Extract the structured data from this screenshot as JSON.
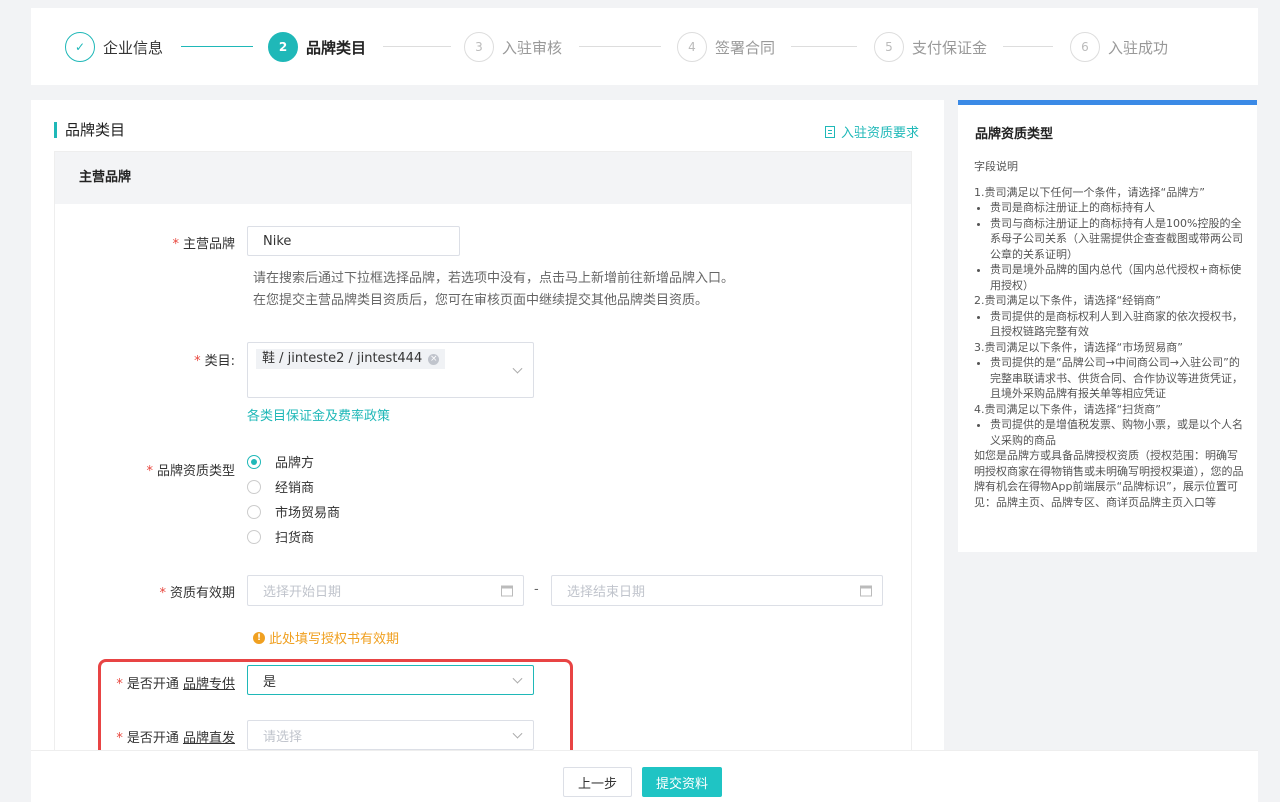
{
  "steps": [
    {
      "num": "✓",
      "label": "企业信息",
      "state": "done"
    },
    {
      "num": "2",
      "label": "品牌类目",
      "state": "active"
    },
    {
      "num": "3",
      "label": "入驻审核",
      "state": "todo"
    },
    {
      "num": "4",
      "label": "签署合同",
      "state": "todo"
    },
    {
      "num": "5",
      "label": "支付保证金",
      "state": "todo"
    },
    {
      "num": "6",
      "label": "入驻成功",
      "state": "todo"
    }
  ],
  "main": {
    "title": "品牌类目",
    "requirements_link": "入驻资质要求",
    "box_title": "主营品牌",
    "brand": {
      "label": "主营品牌",
      "value": "Nike",
      "hint_1": "请在搜索后通过下拉框选择品牌，若选项中没有，点击马上新增前往新增品牌入口。",
      "hint_2": "在您提交主营品牌类目资质后，您可在审核页面中继续提交其他品牌类目资质。"
    },
    "category": {
      "label": "类目:",
      "tag": "鞋 / jinteste2 / jintest444",
      "policy_link": "各类目保证金及费率政策"
    },
    "qualification": {
      "label": "品牌资质类型",
      "options": [
        "品牌方",
        "经销商",
        "市场贸易商",
        "扫货商"
      ],
      "selected": "品牌方"
    },
    "validity": {
      "label": "资质有效期",
      "start_placeholder": "选择开始日期",
      "separator": "-",
      "end_placeholder": "选择结束日期",
      "warning": "此处填写授权书有效期"
    },
    "exclusive": {
      "label_prefix": "是否开通",
      "label_link": "品牌专供",
      "value": "是"
    },
    "direct": {
      "label_prefix": "是否开通",
      "label_link": "品牌直发",
      "placeholder": "请选择"
    }
  },
  "side": {
    "title": "品牌资质类型",
    "subtitle": "字段说明",
    "s1": "1.贵司满足以下任何一个条件，请选择“品牌方”",
    "s1_items": [
      "贵司是商标注册证上的商标持有人",
      "贵司与商标注册证上的商标持有人是100%控股的全系母子公司关系（入驻需提供企查查截图或带两公司公章的关系证明）",
      "贵司是境外品牌的国内总代（国内总代授权+商标使用授权）"
    ],
    "s2": "2.贵司满足以下条件，请选择“经销商”",
    "s2_items": [
      "贵司提供的是商标权利人到入驻商家的依次授权书，且授权链路完整有效"
    ],
    "s3": "3.贵司满足以下条件，请选择“市场贸易商”",
    "s3_items": [
      "贵司提供的是“品牌公司→中间商公司→入驻公司”的完整串联请求书、供货合同、合作协议等进货凭证，且境外采购品牌有报关单等相应凭证"
    ],
    "s4": "4.贵司满足以下条件，请选择“扫货商”",
    "s4_items": [
      "贵司提供的是增值税发票、购物小票，或是以个人名义采购的商品"
    ],
    "note": "如您是品牌方或具备品牌授权资质（授权范围：明确写明授权商家在得物销售或未明确写明授权渠道），您的品牌有机会在得物App前端展示“品牌标识”，展示位置可见：品牌主页、品牌专区、商详页品牌主页入口等"
  },
  "footer": {
    "prev": "上一步",
    "submit": "提交资料"
  },
  "colors": {
    "accent": "#1fb8b8",
    "side_bar": "#3b8ae6",
    "highlight": "#e84444",
    "warning": "#f0a020"
  }
}
